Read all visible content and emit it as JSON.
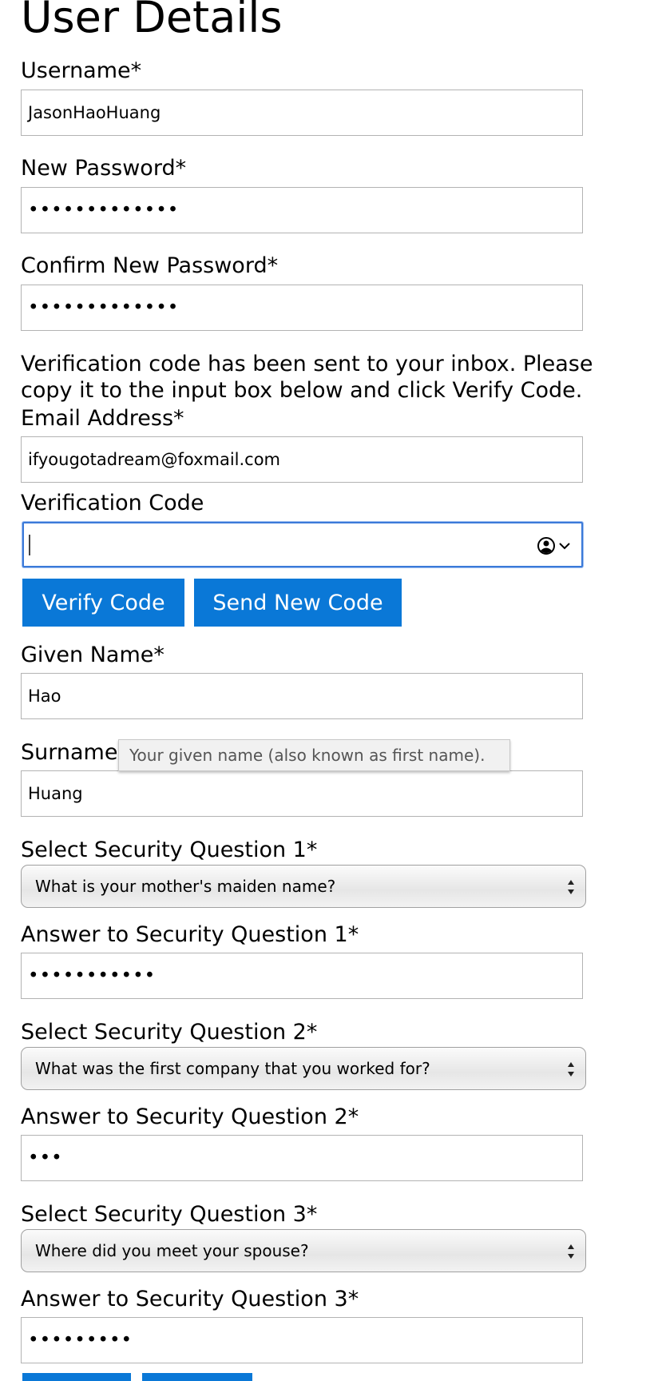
{
  "page": {
    "title": "User Details"
  },
  "username": {
    "label": "Username*",
    "value": "JasonHaoHuang"
  },
  "new_password": {
    "label": "New Password*",
    "value": "•••••••••••••"
  },
  "confirm_password": {
    "label": "Confirm New Password*",
    "value": "•••••••••••••"
  },
  "verification_info": "Verification code has been sent to your inbox. Please copy it to the input box below and click Verify Code.",
  "email": {
    "label": "Email Address*",
    "value": "ifyougotadream@foxmail.com"
  },
  "verification_code": {
    "label": "Verification Code",
    "value": "",
    "autofill_icon": "person-circle-icon"
  },
  "buttons": {
    "verify": "Verify Code",
    "send_new": "Send New Code"
  },
  "given_name": {
    "label": "Given Name*",
    "value": "Hao"
  },
  "surname": {
    "label": "Surname*",
    "value": "Huang"
  },
  "tooltip": "Your given name (also known as first name).",
  "security": [
    {
      "select_label": "Select Security Question 1*",
      "question": "What is your mother's maiden name?",
      "answer_label": "Answer to Security Question 1*",
      "answer": "•••••••••••"
    },
    {
      "select_label": "Select Security Question 2*",
      "question": "What was the first company that you worked for?",
      "answer_label": "Answer to Security Question 2*",
      "answer": "•••"
    },
    {
      "select_label": "Select Security Question 3*",
      "question": "Where did you meet your spouse?",
      "answer_label": "Answer to Security Question 3*",
      "answer": "•••••••••"
    }
  ],
  "colors": {
    "button_bg": "#0a78d7",
    "focus_border": "#3b7ad9",
    "field_border": "#b3b3b3"
  }
}
